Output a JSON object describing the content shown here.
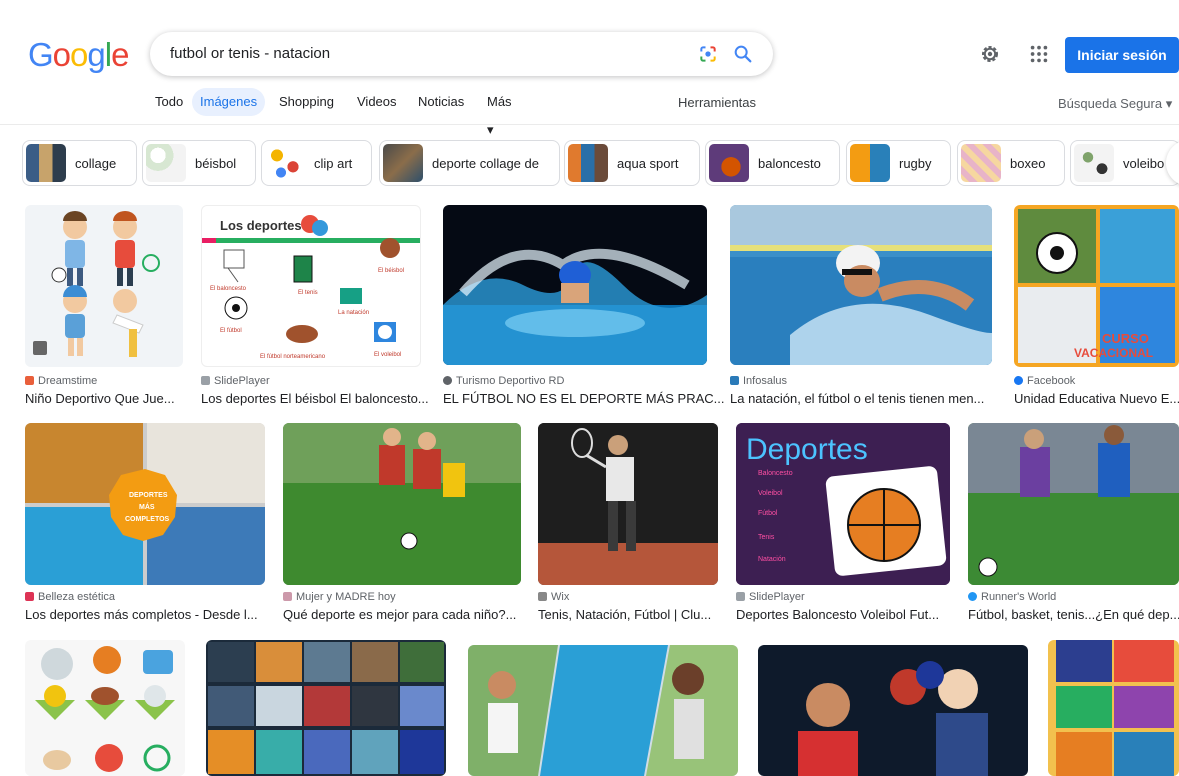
{
  "header": {
    "logo_letters": [
      "G",
      "o",
      "o",
      "g",
      "l",
      "e"
    ],
    "logo_colors": [
      "#4285F4",
      "#EA4335",
      "#FBBC05",
      "#4285F4",
      "#34A853",
      "#EA4335"
    ],
    "query": "futbol or tenis - natacion",
    "signin_label": "Iniciar sesión",
    "lens_icon": "lens-icon",
    "search_icon": "search-icon",
    "settings_icon": "gear-icon",
    "apps_icon": "apps-grid-icon"
  },
  "tabs": {
    "items": [
      "Todo",
      "Imágenes",
      "Shopping",
      "Videos",
      "Noticias",
      "Más ▾"
    ],
    "active": "Imágenes",
    "tools": "Herramientas",
    "safe_search": "Búsqueda Segura ▾"
  },
  "chips": [
    "collage",
    "béisbol",
    "clip art",
    "deporte collage de",
    "aqua sport",
    "baloncesto",
    "rugby",
    "boxeo",
    "voleibo"
  ],
  "results": [
    {
      "source": "Dreamstime",
      "title": "Niño Deportivo Que Jue...",
      "color": "#e95f3b"
    },
    {
      "source": "SlidePlayer",
      "title": "Los deportes El béisbol El baloncesto...",
      "color": "#9aa0a6"
    },
    {
      "source": "Turismo Deportivo RD",
      "title": "EL FÚTBOL NO ES EL DEPORTE MÁS PRAC...",
      "color": "#5f6368"
    },
    {
      "source": "Infosalus",
      "title": "La natación, el fútbol o el tenis tienen men...",
      "color": "#2a7ab8"
    },
    {
      "source": "Facebook",
      "title": "Unidad Educativa Nuevo E...",
      "color": "#1877f2"
    },
    {
      "source": "Belleza estética",
      "title": "Los deportes más completos - Desde l...",
      "color": "#d35"
    },
    {
      "source": "Mujer y MADRE hoy",
      "title": "Qué deporte es mejor para cada niño?...",
      "color": "#c9a"
    },
    {
      "source": "Wix",
      "title": "Tenis, Natación, Fútbol | Clu...",
      "color": "#888"
    },
    {
      "source": "SlidePlayer",
      "title": "Deportes Baloncesto Voleibol Fut...",
      "color": "#9aa0a6"
    },
    {
      "source": "Runner's World",
      "title": "Fútbol, basket, tenis...¿En qué dep...",
      "color": "#2196f3"
    }
  ],
  "image_texts": {
    "slide_title": "Los deportes",
    "slide_labels": [
      "El baloncesto",
      "El tenis",
      "El béisbol",
      "El fútbol",
      "La natación",
      "El fútbol norteamericano",
      "El voleibol"
    ],
    "curso": "CURSO",
    "vacacional": "VACACIONAL",
    "badge_lines": [
      "DEPORTES",
      "MÁS",
      "COMPLETOS"
    ],
    "deportes_word": "Deportes",
    "deportes_list": [
      "Baloncesto",
      "Voleibol",
      "Fútbol",
      "Tenis",
      "Natación"
    ]
  }
}
